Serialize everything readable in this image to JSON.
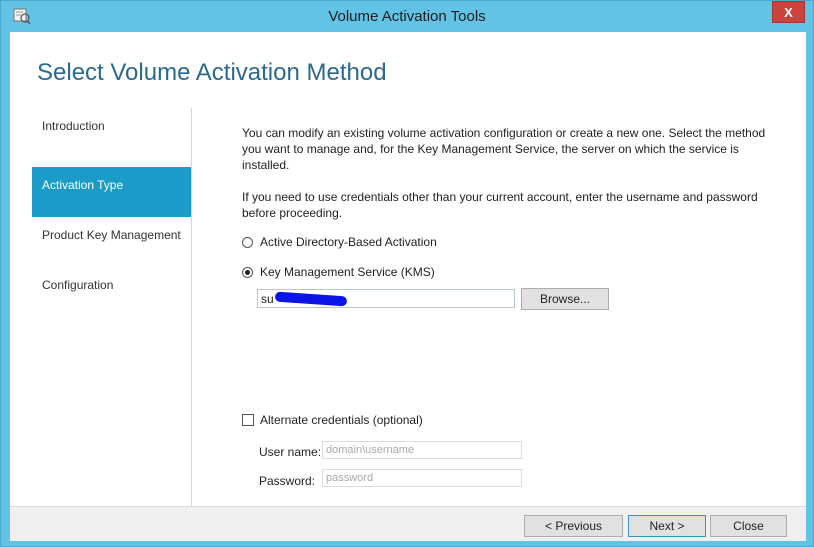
{
  "window": {
    "title": "Volume Activation Tools",
    "close_glyph": "X"
  },
  "page": {
    "heading": "Select Volume Activation Method"
  },
  "nav": {
    "items": [
      {
        "label": "Introduction"
      },
      {
        "label": "Activation Type"
      },
      {
        "label": "Product Key Management"
      },
      {
        "label": "Configuration"
      }
    ],
    "active_index": 1
  },
  "content": {
    "paragraph1": "You can modify an existing volume activation configuration or create a new one. Select the method you want to manage and, for the Key Management Service, the server on which the service is installed.",
    "paragraph2": "If you need to use credentials other than your current account, enter the username and password before proceeding.",
    "options": [
      {
        "label": "Active Directory-Based Activation",
        "selected": false
      },
      {
        "label": "Key Management Service (KMS)",
        "selected": true
      }
    ],
    "kms_server_value": "su",
    "browse_label": "Browse...",
    "alt_creds_label": "Alternate credentials (optional)",
    "alt_creds_checked": false,
    "username_label": "User name:",
    "username_placeholder": "domain\\username",
    "password_label": "Password:",
    "password_placeholder": "password"
  },
  "footer": {
    "previous_label": "< Previous",
    "next_label": "Next >",
    "close_label": "Close"
  },
  "colors": {
    "accent": "#1b9bc7",
    "title_bar": "#63c3e6",
    "heading": "#2b6a8e",
    "close": "#c9433f",
    "redaction": "#0a15e6"
  }
}
